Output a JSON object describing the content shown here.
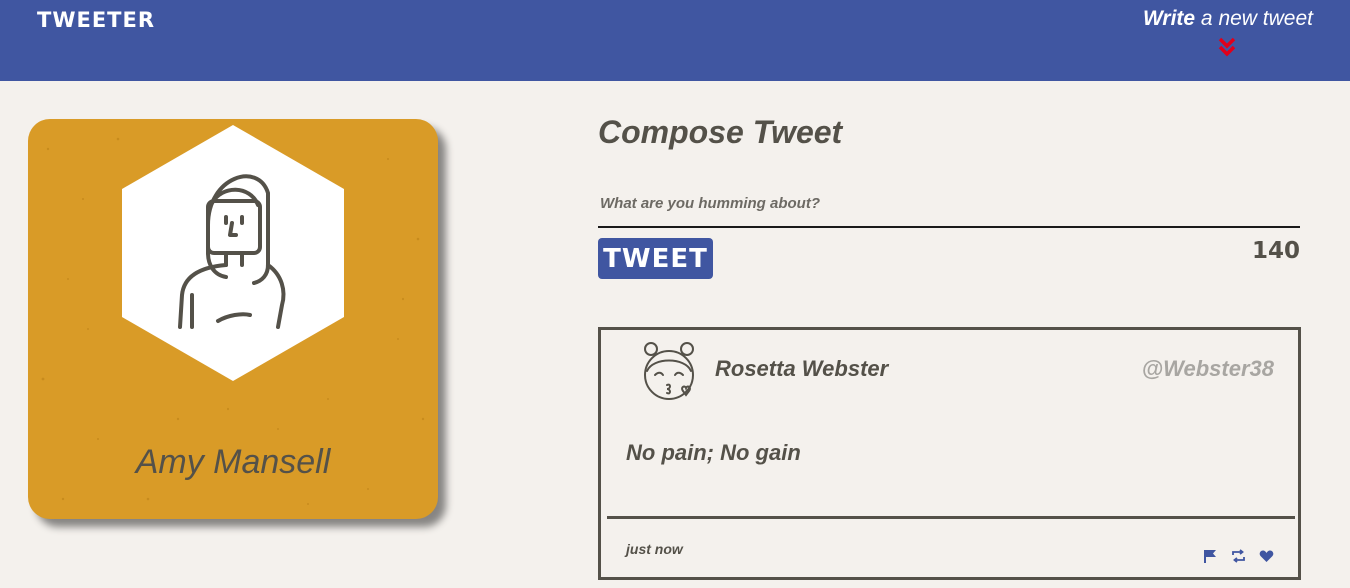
{
  "nav": {
    "brand": "TWEETER",
    "write_bold": "Write",
    "write_rest": " a new tweet",
    "chevron_icon": "double-chevron-down-icon",
    "chevron_color": "#e0001b"
  },
  "profile": {
    "name": "Amy Mansell",
    "avatar_icon": "woman-avatar-icon",
    "card_color": "#d99b27"
  },
  "compose": {
    "title": "Compose Tweet",
    "placeholder": "What are you humming about?",
    "button_label": "TWEET",
    "counter": "140"
  },
  "tweet": {
    "avatar_icon": "girl-kiss-avatar-icon",
    "name": "Rosetta Webster",
    "handle": "@Webster38",
    "body": "No pain; No gain",
    "time": "just now",
    "actions": [
      "flag-icon",
      "retweet-icon",
      "heart-icon"
    ]
  },
  "colors": {
    "accent": "#4056a1",
    "text": "#545149",
    "background": "#f4f1ed"
  }
}
